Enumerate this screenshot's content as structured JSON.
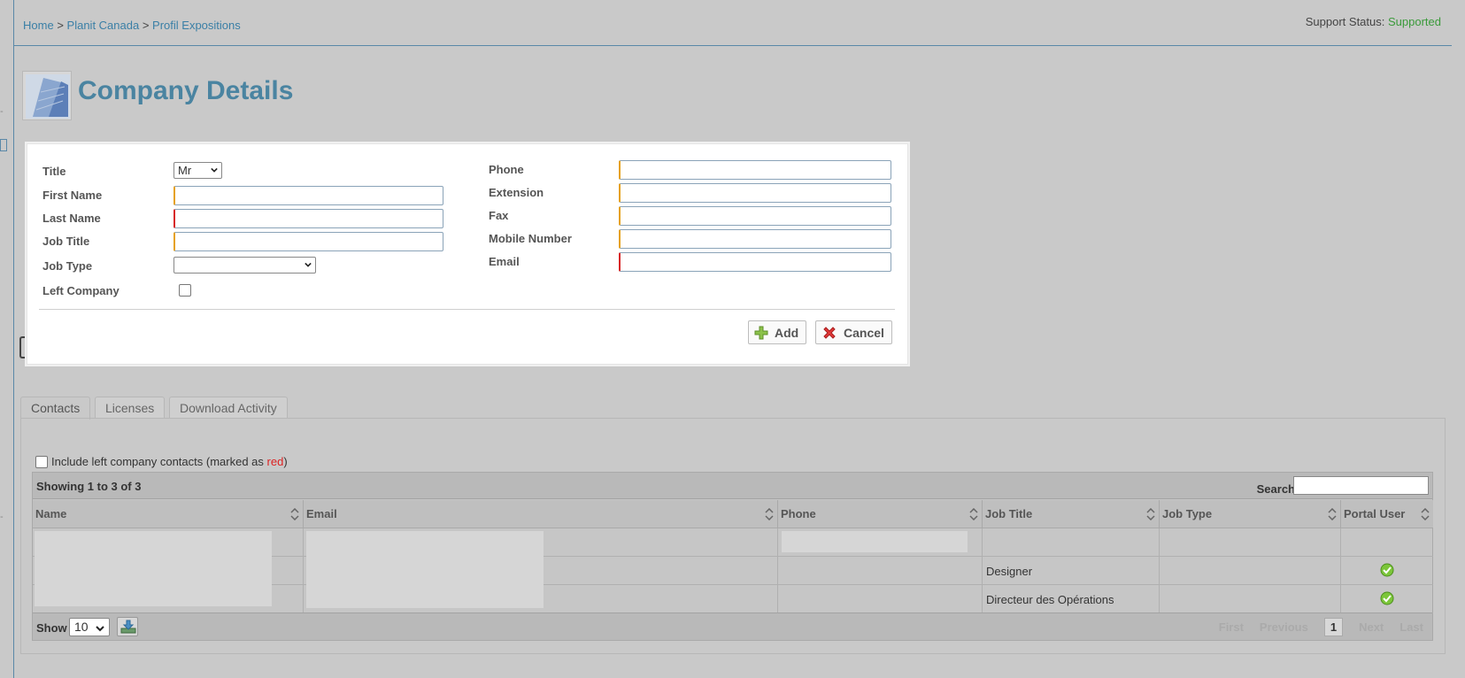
{
  "breadcrumb": [
    "Home",
    "Planit Canada",
    "Profil Expositions"
  ],
  "breadcrumb_sep": ">",
  "support": {
    "label": "Support Status:",
    "value": "Supported"
  },
  "page_title": "Company Details",
  "form": {
    "title_label": "Title",
    "title_value": "Mr",
    "first_name_label": "First Name",
    "last_name_label": "Last Name",
    "job_title_label": "Job Title",
    "job_type_label": "Job Type",
    "left_company_label": "Left Company",
    "phone_label": "Phone",
    "extension_label": "Extension",
    "fax_label": "Fax",
    "mobile_label": "Mobile Number",
    "email_label": "Email",
    "add_label": "Add",
    "cancel_label": "Cancel"
  },
  "tabs": [
    "Contacts",
    "Licenses",
    "Download Activity"
  ],
  "include_left": {
    "prefix": "Include left company contacts (marked as ",
    "red": "red",
    "suffix": ")"
  },
  "grid": {
    "showing": "Showing 1 to 3 of 3",
    "search_label": "Search",
    "columns": [
      "Name",
      "Email",
      "Phone",
      "Job Title",
      "Job Type",
      "Portal User"
    ],
    "rows": [
      {
        "job_title": "",
        "portal": false
      },
      {
        "job_title": "Designer",
        "portal": true
      },
      {
        "job_title": "Directeur des Opérations",
        "portal": true
      }
    ],
    "show_label": "Show",
    "page_size": "10",
    "pager": {
      "first": "First",
      "previous": "Previous",
      "current": "1",
      "next": "Next",
      "last": "Last"
    }
  },
  "colors": {
    "accent": "#4a84a1",
    "link": "#3a7fa6",
    "supported": "#3a9a3a",
    "required": "#d82424",
    "optional": "#e6a118"
  }
}
